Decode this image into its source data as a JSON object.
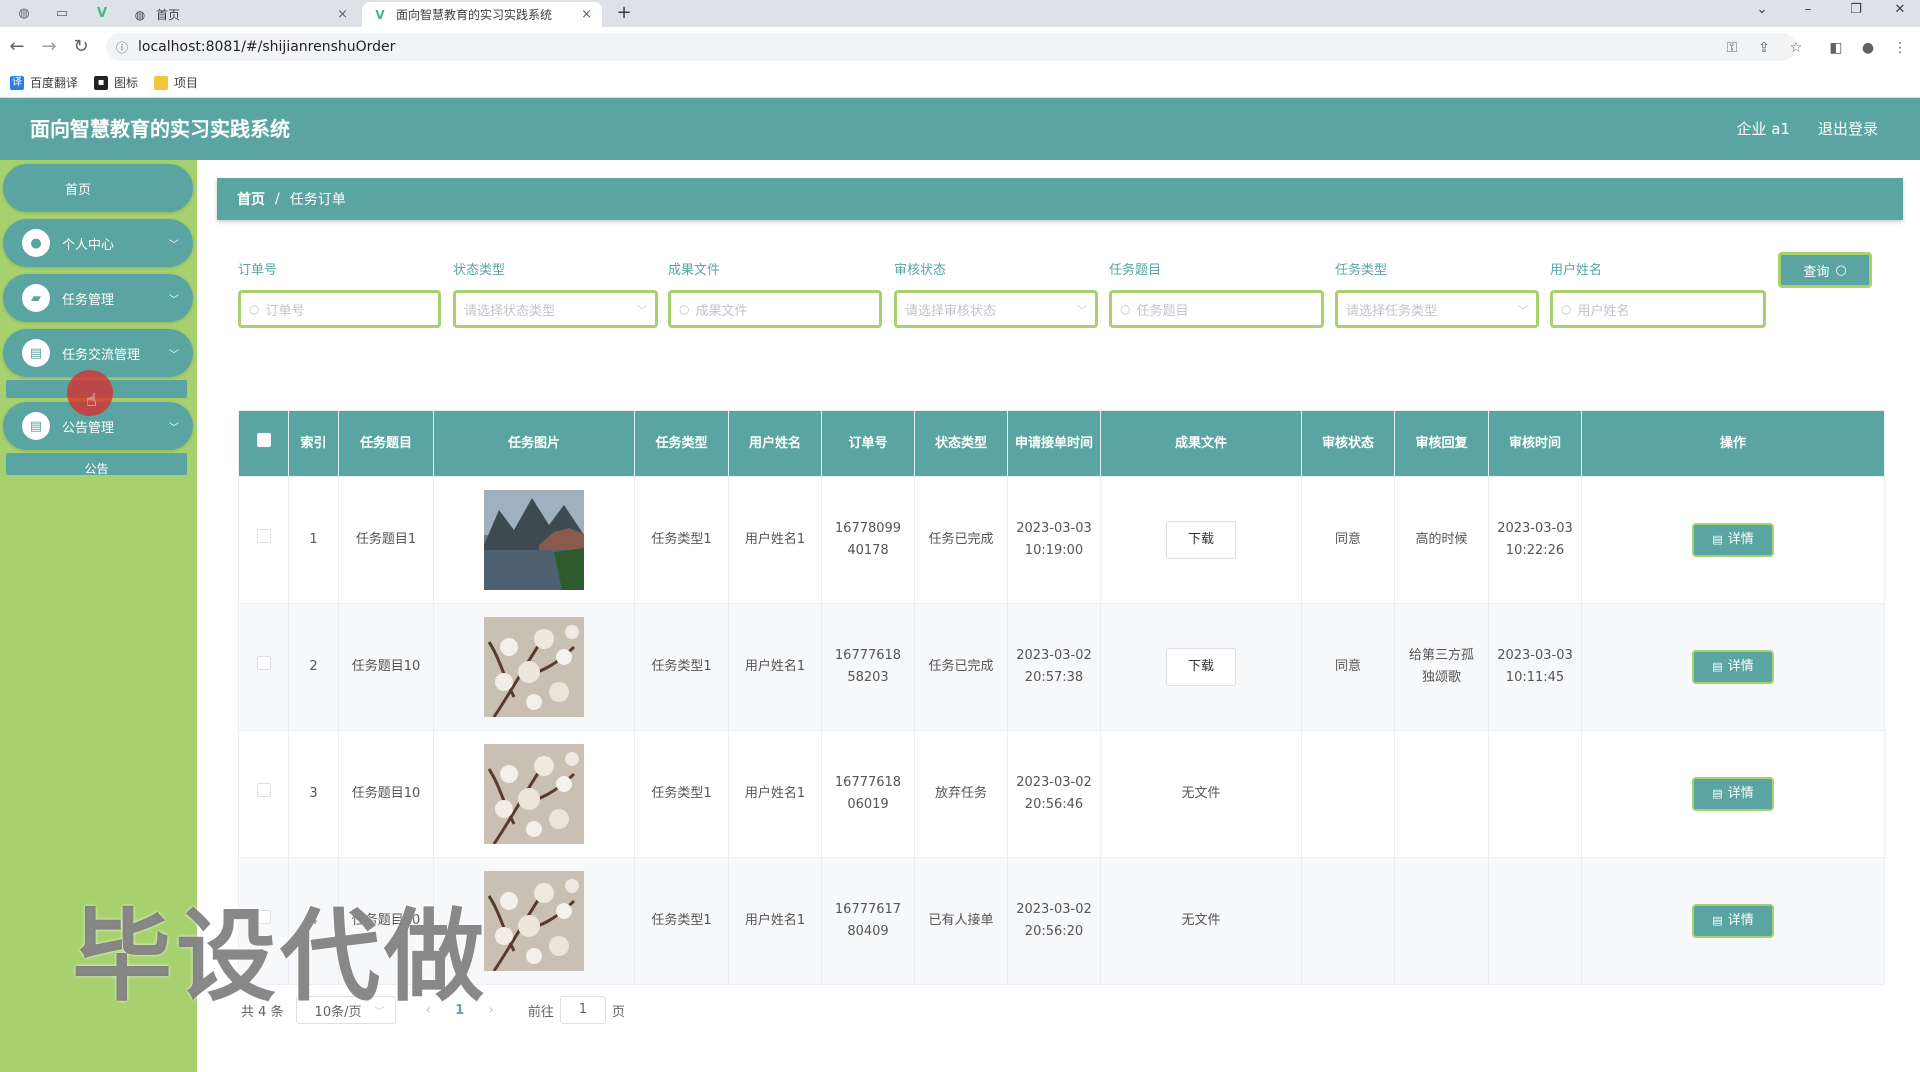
{
  "browser": {
    "tabs": [
      {
        "title": "首页",
        "close": "×"
      },
      {
        "title": "面向智慧教育的实习实践系统",
        "close": "×"
      }
    ],
    "new_tab": "+",
    "url": "localhost:8081/#/shijianrenshuOrder",
    "bookmarks": [
      "百度翻译",
      "图标",
      "项目"
    ]
  },
  "header": {
    "title": "面向智慧教育的实习实践系统",
    "user": "企业 a1",
    "logout": "退出登录"
  },
  "sidebar": {
    "home": "首页",
    "menus": [
      "个人中心",
      "任务管理",
      "任务交流管理",
      "公告管理"
    ],
    "submenus": [
      "",
      "公告"
    ]
  },
  "breadcrumb": {
    "home": "首页",
    "sep": "/",
    "current": "任务订单"
  },
  "filters": [
    {
      "label": "订单号",
      "placeholder": "订单号"
    },
    {
      "label": "状态类型",
      "placeholder": "请选择状态类型"
    },
    {
      "label": "成果文件",
      "placeholder": "成果文件"
    },
    {
      "label": "审核状态",
      "placeholder": "请选择审核状态"
    },
    {
      "label": "任务题目",
      "placeholder": "任务题目"
    },
    {
      "label": "任务类型",
      "placeholder": "请选择任务类型"
    },
    {
      "label": "用户姓名",
      "placeholder": "用户姓名"
    }
  ],
  "search_button": "查询",
  "table": {
    "columns": [
      "索引",
      "任务题目",
      "任务图片",
      "任务类型",
      "用户姓名",
      "订单号",
      "状态类型",
      "申请接单时间",
      "成果文件",
      "审核状态",
      "审核回复",
      "审核时间",
      "操作"
    ],
    "rows": [
      {
        "index": "1",
        "title": "任务题目1",
        "type": "任务类型1",
        "user": "用户姓名1",
        "order": "1677809940178",
        "status": "任务已完成",
        "apply_time": "2023-03-03 10:19:00",
        "file": "下载",
        "audit": "同意",
        "reply": "高的时候",
        "audit_time": "2023-03-03 10:22:26",
        "action": "详情"
      },
      {
        "index": "2",
        "title": "任务题目10",
        "type": "任务类型1",
        "user": "用户姓名1",
        "order": "1677761858203",
        "status": "任务已完成",
        "apply_time": "2023-03-02 20:57:38",
        "file": "下载",
        "audit": "同意",
        "reply": "给第三方孤独颂歌",
        "audit_time": "2023-03-03 10:11:45",
        "action": "详情"
      },
      {
        "index": "3",
        "title": "任务题目10",
        "type": "任务类型1",
        "user": "用户姓名1",
        "order": "1677761806019",
        "status": "放弃任务",
        "apply_time": "2023-03-02 20:56:46",
        "file": "无文件",
        "audit": "",
        "reply": "",
        "audit_time": "",
        "action": "详情"
      },
      {
        "index": "4",
        "title": "任务题目10",
        "type": "任务类型1",
        "user": "用户姓名1",
        "order": "1677761780409",
        "status": "已有人接单",
        "apply_time": "2023-03-02 20:56:20",
        "file": "无文件",
        "audit": "",
        "reply": "",
        "audit_time": "",
        "action": "详情"
      }
    ]
  },
  "pagination": {
    "total": "共 4 条",
    "page_size": "10条/页",
    "current": "1",
    "goto": "前往",
    "goto_value": "1",
    "page_suffix": "页"
  },
  "watermark": "毕设代做",
  "colors": {
    "primary": "#5aa5a1",
    "accent": "#a6d16e"
  }
}
